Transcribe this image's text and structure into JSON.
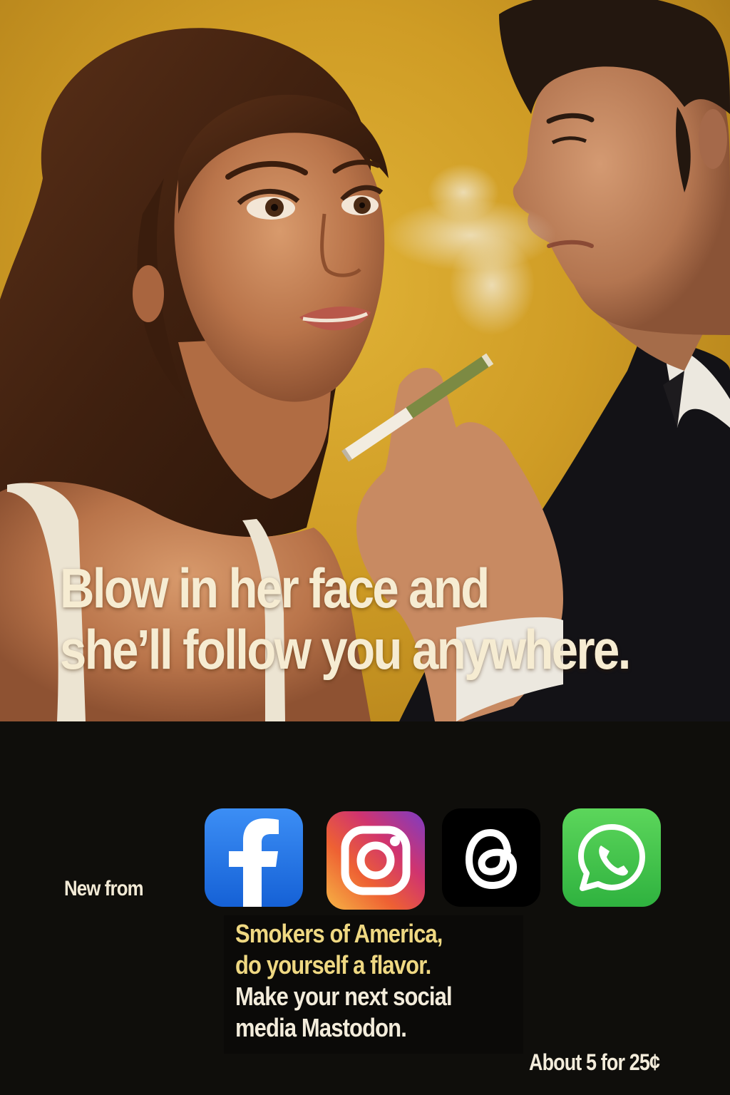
{
  "poster": {
    "headline_line1": "Blow in her face and",
    "headline_line2": "she’ll follow you anywhere.",
    "new_from": "New from",
    "apps": [
      {
        "name": "Facebook",
        "icon": "facebook-icon"
      },
      {
        "name": "Instagram",
        "icon": "instagram-icon"
      },
      {
        "name": "Threads",
        "icon": "threads-icon"
      },
      {
        "name": "WhatsApp",
        "icon": "whatsapp-icon"
      }
    ],
    "tagline": {
      "line1": "Smokers of America,",
      "line2": "do yourself a flavor.",
      "line3": "Make your next social",
      "line4": "media Mastodon."
    },
    "price": "About 5 for 25¢"
  },
  "colors": {
    "background_yellow": "#d1a22a",
    "band_black": "#0f0e0b",
    "headline_cream": "#f6ecd2",
    "tagline_yellow": "#efd882",
    "facebook_blue": "#1877f2",
    "whatsapp_green": "#3fc24c"
  }
}
